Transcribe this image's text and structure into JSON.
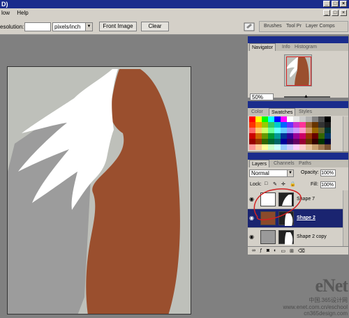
{
  "window": {
    "title": "D)",
    "controls": [
      "_",
      "□",
      "×"
    ]
  },
  "menu": {
    "items": [
      "low",
      "Help"
    ]
  },
  "options": {
    "resolution_label": "esolution:",
    "resolution_value": "",
    "unit_value": "pixels/inch",
    "front_image_label": "Front Image",
    "clear_label": "Clear"
  },
  "dock": {
    "tabs": [
      "Brushes",
      "Tool Pr",
      "Layer Comps"
    ]
  },
  "navigator": {
    "tabs": [
      "Navigator",
      "Info",
      "Histogram"
    ],
    "zoom_value": "50%"
  },
  "swatches": {
    "tabs": [
      "Color",
      "Swatches",
      "Styles"
    ],
    "colors": [
      "#ff0000",
      "#ffff00",
      "#00ff00",
      "#00ffff",
      "#0000ff",
      "#ff00ff",
      "#ffffff",
      "#e6e6e6",
      "#cccccc",
      "#b3b3b3",
      "#808080",
      "#4d4d4d",
      "#000000",
      "#ff3300",
      "#ff9900",
      "#99cc00",
      "#33cc66",
      "#00cccc",
      "#0066ff",
      "#6633ff",
      "#cc33cc",
      "#ff3399",
      "#996633",
      "#663300",
      "#333333",
      "#1a1a1a",
      "#ff6666",
      "#ffcc66",
      "#ccff66",
      "#66ff99",
      "#66ffff",
      "#66ccff",
      "#9999ff",
      "#cc99ff",
      "#ff99cc",
      "#cc9966",
      "#996600",
      "#666633",
      "#003333",
      "#cc0000",
      "#cc6600",
      "#669900",
      "#009933",
      "#009999",
      "#003399",
      "#330099",
      "#990099",
      "#cc0066",
      "#993300",
      "#660000",
      "#336600",
      "#003366",
      "#990000",
      "#993300",
      "#336600",
      "#006633",
      "#006666",
      "#000099",
      "#330066",
      "#660066",
      "#990033",
      "#663300",
      "#330000",
      "#003300",
      "#000033",
      "#ff9999",
      "#ffcc99",
      "#ffff99",
      "#ccffcc",
      "#ccffff",
      "#99ccff",
      "#ccccff",
      "#ffccff",
      "#ffcccc",
      "#e6c39a",
      "#c8a070",
      "#a07850",
      "#785030"
    ]
  },
  "layers": {
    "tabs": [
      "Layers",
      "Channels",
      "Paths"
    ],
    "blend_mode": "Normal",
    "opacity_label": "Opacity:",
    "opacity_value": "100%",
    "lock_label": "Lock:",
    "fill_label": "Fill:",
    "fill_value": "100%",
    "items": [
      {
        "name": "Shape 7",
        "selected": false,
        "thumb_color": "#ffffff"
      },
      {
        "name": "Shape 2",
        "selected": true,
        "thumb_color": "#8b4a2b"
      },
      {
        "name": "Shape 2 copy",
        "selected": false,
        "thumb_color": "#9a9a9a"
      }
    ]
  },
  "watermark": {
    "logo": "eNet",
    "cn_text": "中国.365设计网",
    "url_left": "www.enet.com.cn/eschool",
    "url_right": "cn365design.com"
  },
  "colors": {
    "title_blue": "#1a2c8c",
    "skin": "#9a4f2e",
    "shadow": "#9c9c9c",
    "canvas_bg": "#bec0ba",
    "annotation_red": "#d22222"
  }
}
